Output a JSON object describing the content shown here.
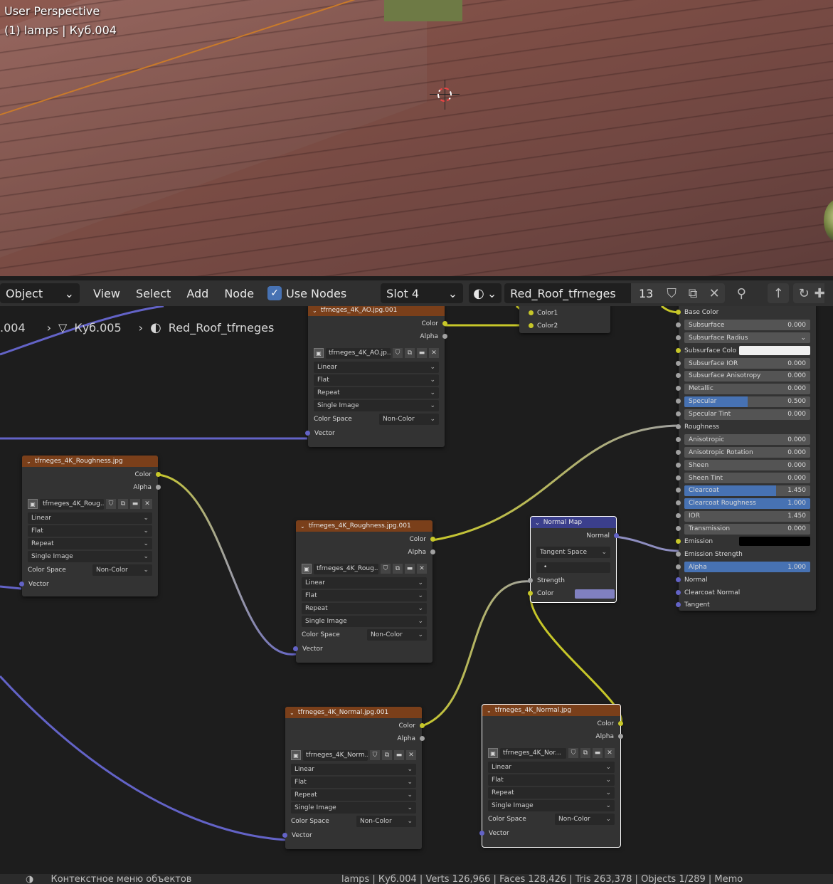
{
  "viewport": {
    "title": "User Perspective",
    "subtitle": "(1) lamps | Куб.004"
  },
  "header": {
    "mode": "Object",
    "menus": [
      "View",
      "Select",
      "Add",
      "Node"
    ],
    "use_nodes_label": "Use Nodes",
    "use_nodes_checked": true,
    "slot": "Slot 4",
    "material_name": "Red_Roof_tfrneges",
    "user_count": "13"
  },
  "breadcrumb": {
    "object": ".004",
    "mesh": "Куб.005",
    "material": "Red_Roof_tfrneges"
  },
  "image_nodes": [
    {
      "id": "ao",
      "title": "tfrneges_4K_AO.jpg.001",
      "image_name": "tfrneges_4K_AO.jp...",
      "outputs": [
        "Color",
        "Alpha"
      ],
      "interpolation": "Linear",
      "projection": "Flat",
      "extension": "Repeat",
      "source": "Single Image",
      "color_space_label": "Color Space",
      "color_space": "Non-Color",
      "input": "Vector"
    },
    {
      "id": "rough",
      "title": "tfrneges_4K_Roughness.jpg",
      "image_name": "tfrneges_4K_Roug...",
      "outputs": [
        "Color",
        "Alpha"
      ],
      "interpolation": "Linear",
      "projection": "Flat",
      "extension": "Repeat",
      "source": "Single Image",
      "color_space_label": "Color Space",
      "color_space": "Non-Color",
      "input": "Vector"
    },
    {
      "id": "rough001",
      "title": "tfrneges_4K_Roughness.jpg.001",
      "image_name": "tfrneges_4K_Roug...",
      "outputs": [
        "Color",
        "Alpha"
      ],
      "interpolation": "Linear",
      "projection": "Flat",
      "extension": "Repeat",
      "source": "Single Image",
      "color_space_label": "Color Space",
      "color_space": "Non-Color",
      "input": "Vector"
    },
    {
      "id": "normal001",
      "title": "tfrneges_4K_Normal.jpg.001",
      "image_name": "tfrneges_4K_Norm...",
      "outputs": [
        "Color",
        "Alpha"
      ],
      "interpolation": "Linear",
      "projection": "Flat",
      "extension": "Repeat",
      "source": "Single Image",
      "color_space_label": "Color Space",
      "color_space": "Non-Color",
      "input": "Vector"
    },
    {
      "id": "normal",
      "title": "tfrneges_4K_Normal.jpg",
      "image_name": "tfrneges_4K_Nor...",
      "outputs": [
        "Color",
        "Alpha"
      ],
      "interpolation": "Linear",
      "projection": "Flat",
      "extension": "Repeat",
      "source": "Single Image",
      "color_space_label": "Color Space",
      "color_space": "Non-Color",
      "input": "Vector"
    }
  ],
  "mix_node": {
    "inputs": [
      "Color1",
      "Color2"
    ]
  },
  "normal_map": {
    "title": "Normal Map",
    "output": "Normal",
    "space": "Tangent Space",
    "uv_value": "•",
    "strength_label": "Strength",
    "color_label": "Color",
    "color": "#8080c0"
  },
  "bsdf": [
    {
      "label": "Base Color",
      "kind": "label"
    },
    {
      "label": "Subsurface",
      "kind": "value",
      "value": "0.000",
      "fill": 0
    },
    {
      "label": "Subsurface Radius",
      "kind": "dropdown"
    },
    {
      "label": "Subsurface Colo",
      "kind": "color",
      "color": "#f0f0f0"
    },
    {
      "label": "Subsurface IOR",
      "kind": "value",
      "value": "0.000",
      "fill": 0
    },
    {
      "label": "Subsurface Anisotropy",
      "kind": "value",
      "value": "0.000",
      "fill": 0
    },
    {
      "label": "Metallic",
      "kind": "value",
      "value": "0.000",
      "fill": 0
    },
    {
      "label": "Specular",
      "kind": "value",
      "value": "0.500",
      "fill": 0.5
    },
    {
      "label": "Specular Tint",
      "kind": "value",
      "value": "0.000",
      "fill": 0
    },
    {
      "label": "Roughness",
      "kind": "label"
    },
    {
      "label": "Anisotropic",
      "kind": "value",
      "value": "0.000",
      "fill": 0
    },
    {
      "label": "Anisotropic Rotation",
      "kind": "value",
      "value": "0.000",
      "fill": 0
    },
    {
      "label": "Sheen",
      "kind": "value",
      "value": "0.000",
      "fill": 0
    },
    {
      "label": "Sheen Tint",
      "kind": "value",
      "value": "0.000",
      "fill": 0
    },
    {
      "label": "Clearcoat",
      "kind": "value",
      "value": "1.450",
      "fill": 0.73
    },
    {
      "label": "Clearcoat Roughness",
      "kind": "value",
      "value": "1.000",
      "fill": 1
    },
    {
      "label": "IOR",
      "kind": "value",
      "value": "1.450",
      "fill": 0
    },
    {
      "label": "Transmission",
      "kind": "value",
      "value": "0.000",
      "fill": 0
    },
    {
      "label": "Emission",
      "kind": "color",
      "color": "#000000"
    },
    {
      "label": "Emission Strength",
      "kind": "label"
    },
    {
      "label": "Alpha",
      "kind": "value",
      "value": "1.000",
      "fill": 1
    },
    {
      "label": "Normal",
      "kind": "label"
    },
    {
      "label": "Clearcoat Normal",
      "kind": "label"
    },
    {
      "label": "Tangent",
      "kind": "label"
    }
  ],
  "statusbar": {
    "left": "Контекстное меню объектов",
    "right": "lamps | Куб.004 | Verts 126,966 | Faces 128,426 | Tris 263,378 | Objects 1/289 | Memo"
  }
}
